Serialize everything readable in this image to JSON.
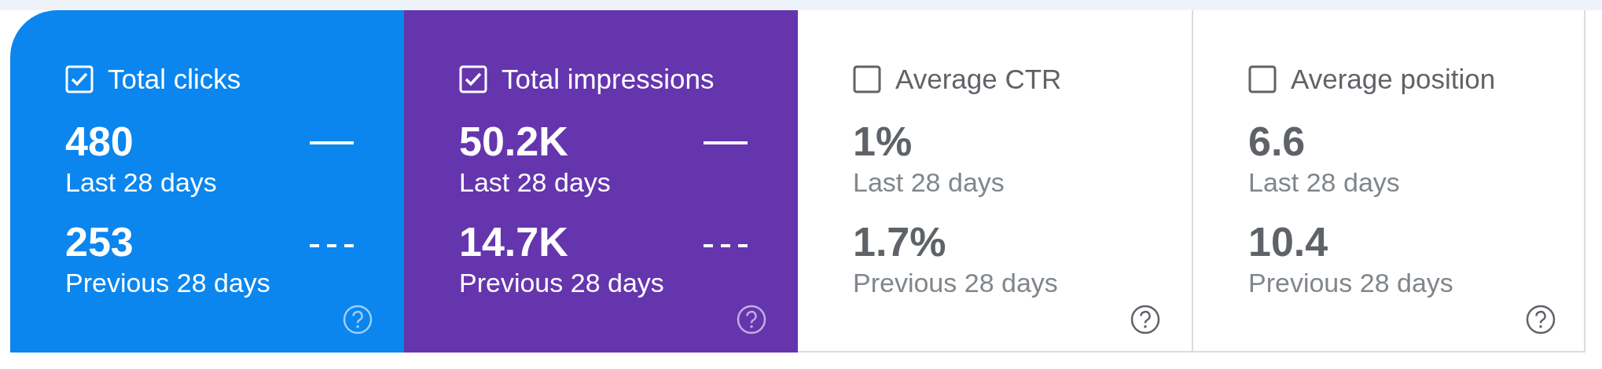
{
  "metrics": [
    {
      "title": "Total clicks",
      "checked": true,
      "color": "#0a86ee",
      "current": {
        "value": "480",
        "label": "Last 28 days"
      },
      "previous": {
        "value": "253",
        "label": "Previous 28 days"
      }
    },
    {
      "title": "Total impressions",
      "checked": true,
      "color": "#6535ae",
      "current": {
        "value": "50.2K",
        "label": "Last 28 days"
      },
      "previous": {
        "value": "14.7K",
        "label": "Previous 28 days"
      }
    },
    {
      "title": "Average CTR",
      "checked": false,
      "current": {
        "value": "1%",
        "label": "Last 28 days"
      },
      "previous": {
        "value": "1.7%",
        "label": "Previous 28 days"
      }
    },
    {
      "title": "Average position",
      "checked": false,
      "current": {
        "value": "6.6",
        "label": "Last 28 days"
      },
      "previous": {
        "value": "10.4",
        "label": "Previous 28 days"
      }
    }
  ]
}
